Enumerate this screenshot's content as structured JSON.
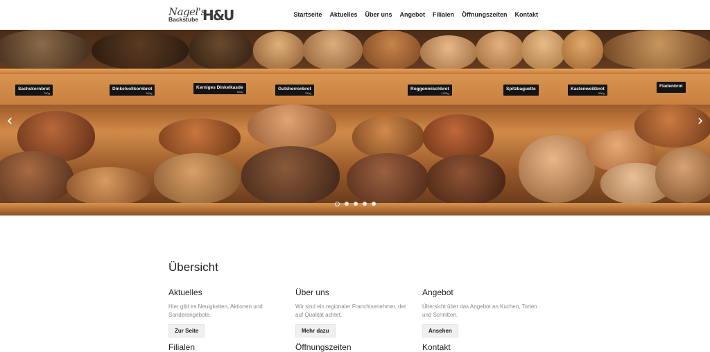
{
  "header": {
    "logo": {
      "script": "Nagel's",
      "sub": "Backstube",
      "mark": "H&U"
    },
    "nav": [
      "Startseite",
      "Aktuelles",
      "Über uns",
      "Angebot",
      "Filialen",
      "Öffnungszeiten",
      "Kontakt"
    ]
  },
  "hero": {
    "labels": [
      {
        "text": "Sachskornbrot",
        "price": "750g"
      },
      {
        "text": "Dinkelvollkornbrot",
        "price": "500g"
      },
      {
        "text": "Kerniges Dinkelkasde",
        "price": "500g"
      },
      {
        "text": "Gutsherrenbrot",
        "price": "750g"
      },
      {
        "text": "Roggenmischbrot",
        "price": "1000g"
      },
      {
        "text": "Spitzbaguette",
        "price": ""
      },
      {
        "text": "Kastenweißbrot",
        "price": "500g"
      },
      {
        "text": "Fladenbrot",
        "price": ""
      }
    ],
    "prev_icon": "chevron-left-icon",
    "next_icon": "chevron-right-icon",
    "slides": 5,
    "active_slide": 1
  },
  "main": {
    "title": "Übersicht",
    "cards": [
      {
        "title": "Aktuelles",
        "text": "Hier gibt es Neuigkeiten, Aktionen und Sonderangebote.",
        "button": "Zur Seite"
      },
      {
        "title": "Über uns",
        "text": "Wir sind ein regionaler Franchisenehmer, der auf Qualität achtet.",
        "button": "Mehr dazu"
      },
      {
        "title": "Angebot",
        "text": "Übersicht über das Angebot an Kuchen, Torten und Schnitten.",
        "button": "Ansehen"
      }
    ],
    "next_row": [
      "Filialen",
      "Öffnungszeiten",
      "Kontakt"
    ]
  }
}
